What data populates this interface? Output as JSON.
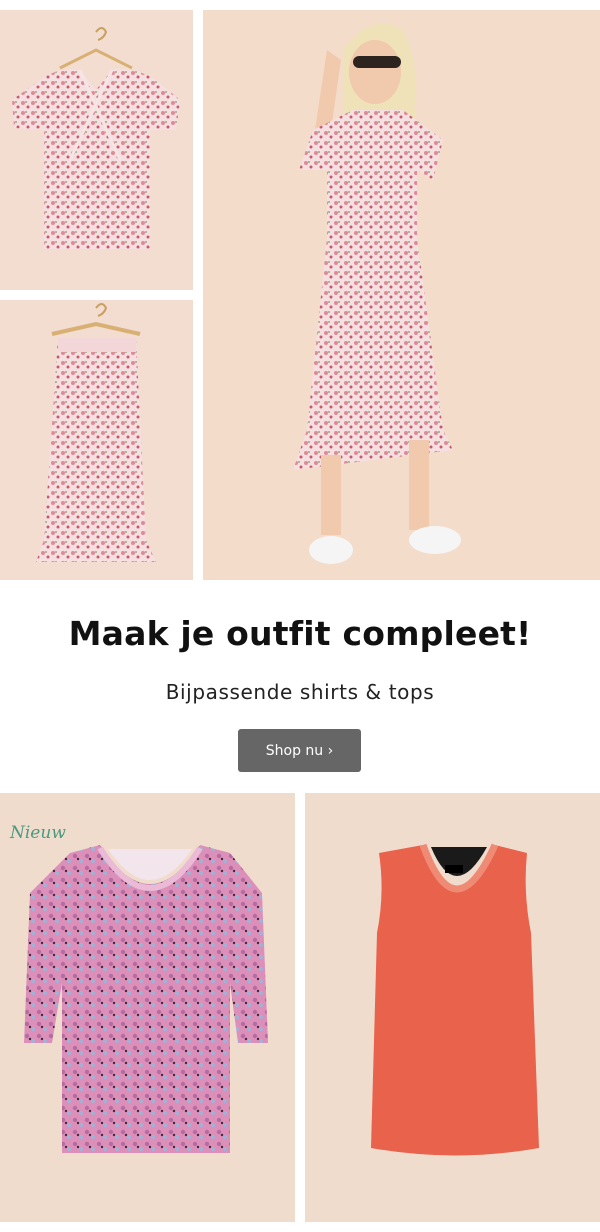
{
  "hero": {
    "images": [
      {
        "name": "wrap-top",
        "alt": "floral-wrap-top-icon"
      },
      {
        "name": "midi-skirt",
        "alt": "floral-skirt-icon"
      },
      {
        "name": "model",
        "alt": "model-outfit-icon"
      }
    ]
  },
  "promo": {
    "headline": "Maak je outfit compleet!",
    "subline": "Bijpassende shirts & tops",
    "button_label": "Shop nu ›"
  },
  "products": [
    {
      "badge": "Nieuw",
      "icon": "floral-shirt-icon"
    },
    {
      "icon": "coral-tank-top-icon"
    }
  ],
  "colors": {
    "tile_bg": "#f2ddd0",
    "button_bg": "#666666",
    "badge": "#4a9a7e",
    "floral_pink": "#e9a9ae",
    "coral": "#e8624c"
  }
}
